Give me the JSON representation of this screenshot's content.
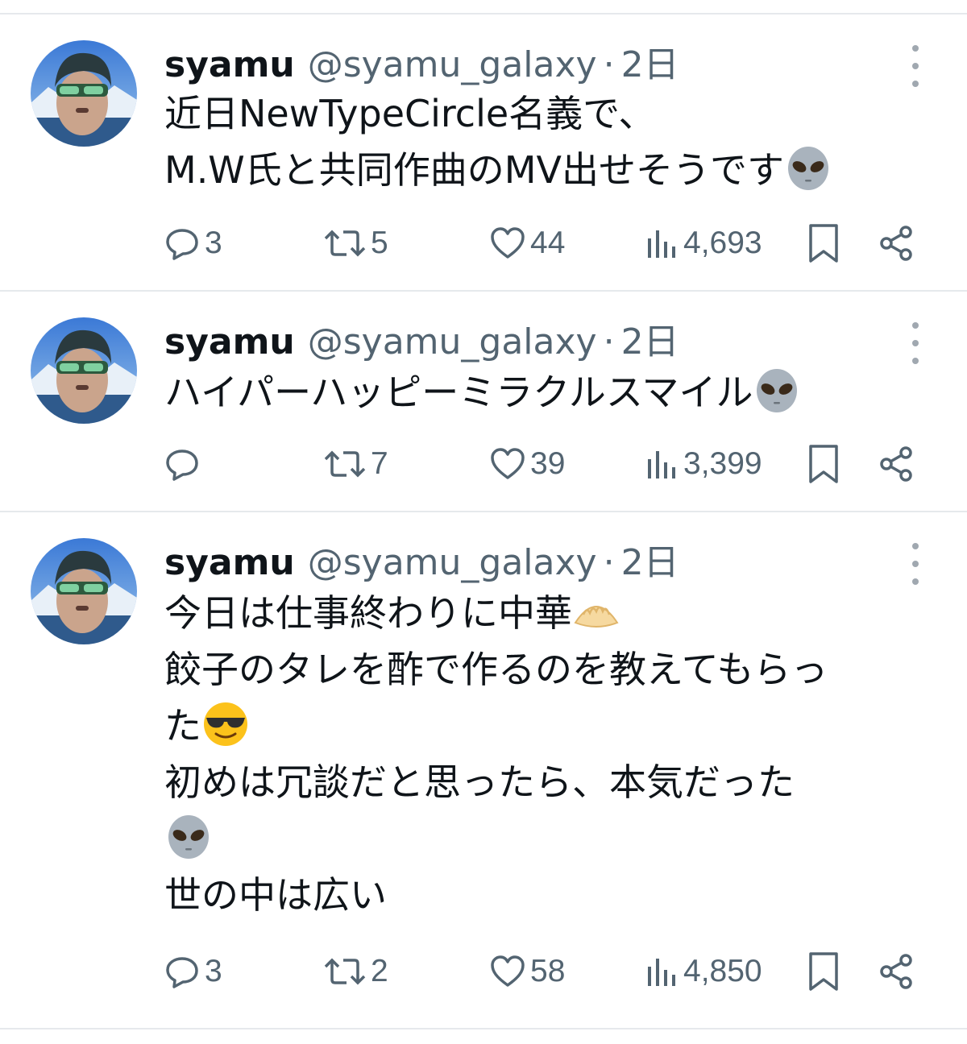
{
  "tweets": [
    {
      "name": "syamu",
      "handle": "@syamu_galaxy",
      "separator": "·",
      "time": "2日",
      "lines": [
        {
          "text": "近日NewTypeCircle名義で、",
          "emoji": ""
        },
        {
          "text": "M.W氏と共同作曲のMV出せそうです",
          "emoji": "alien-emoji"
        }
      ],
      "reply_count": "3",
      "retweet_count": "5",
      "like_count": "44",
      "view_count": "4,693"
    },
    {
      "name": "syamu",
      "handle": "@syamu_galaxy",
      "separator": "·",
      "time": "2日",
      "lines": [
        {
          "text": "ハイパーハッピーミラクルスマイル",
          "emoji": "alien-emoji"
        }
      ],
      "reply_count": "",
      "retweet_count": "7",
      "like_count": "39",
      "view_count": "3,399"
    },
    {
      "name": "syamu",
      "handle": "@syamu_galaxy",
      "separator": "·",
      "time": "2日",
      "lines": [
        {
          "text": "今日は仕事終わりに中華",
          "emoji": "dumpling-emoji"
        },
        {
          "text": "餃子のタレを酢で作るのを教えてもらっ",
          "emoji": ""
        },
        {
          "text": "た",
          "emoji": "sunglasses-emoji"
        },
        {
          "text": "初めは冗談だと思ったら、本気だった",
          "emoji": ""
        },
        {
          "text": "",
          "emoji": "alien-emoji"
        },
        {
          "text": "世の中は広い",
          "emoji": ""
        }
      ],
      "reply_count": "3",
      "retweet_count": "2",
      "like_count": "58",
      "view_count": "4,850"
    }
  ],
  "icons": {
    "reply": "reply-icon",
    "retweet": "retweet-icon",
    "like": "heart-icon",
    "views": "views-icon",
    "bookmark": "bookmark-icon",
    "share": "share-icon",
    "more": "more-icon"
  },
  "colors": {
    "text": "#0f1419",
    "secondary": "#536471",
    "divider": "#e6e9ec"
  }
}
